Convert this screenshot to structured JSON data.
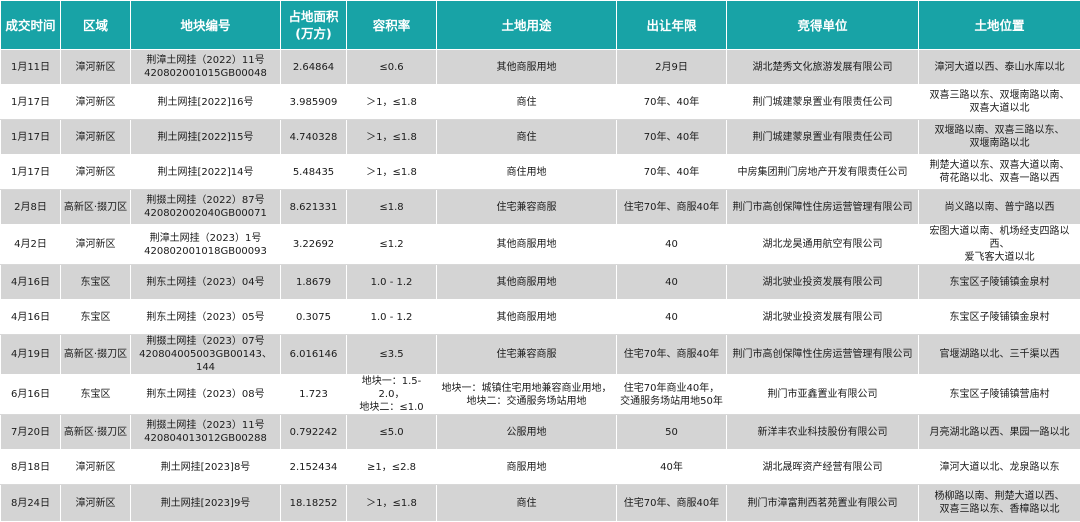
{
  "table": {
    "headers": [
      "成交时间",
      "区域",
      "地块编号",
      "占地面积\n(万方)",
      "容积率",
      "土地用途",
      "出让年限",
      "竞得单位",
      "土地位置"
    ],
    "rows": [
      [
        "1月11日",
        "漳河新区",
        "荆漳土网挂（2022）11号\n420802001015GB00048",
        "2.64864",
        "≤0.6",
        "其他商服用地",
        "2月9日",
        "湖北楚秀文化旅游发展有限公司",
        "漳河大道以西、泰山水库以北"
      ],
      [
        "1月17日",
        "漳河新区",
        "荆土网挂[2022]16号",
        "3.985909",
        "＞1，≤1.8",
        "商住",
        "70年、40年",
        "荆门城建蒙泉置业有限责任公司",
        "双喜三路以东、双堰南路以南、\n双喜大道以北"
      ],
      [
        "1月17日",
        "漳河新区",
        "荆土网挂[2022]15号",
        "4.740328",
        "＞1，≤1.8",
        "商住",
        "70年、40年",
        "荆门城建蒙泉置业有限责任公司",
        "双堰路以南、双喜三路以东、\n双堰南路以北"
      ],
      [
        "1月17日",
        "漳河新区",
        "荆土网挂[2022]14号",
        "5.48435",
        "＞1，≤1.8",
        "商住用地",
        "70年、40年",
        "中房集团荆门房地产开发有限责任公司",
        "荆楚大道以东、双喜大道以南、\n荷花路以北、双喜一路以西"
      ],
      [
        "2月8日",
        "高新区·掇刀区",
        "荆掇土网挂（2022）87号\n420802002040GB00071",
        "8.621331",
        "≤1.8",
        "住宅兼容商服",
        "住宅70年、商服40年",
        "荆门市高创保障性住房运营管理有限公司",
        "尚义路以南、普宁路以西"
      ],
      [
        "4月2日",
        "漳河新区",
        "荆漳土网挂（2023）1号\n420802001018GB00093",
        "3.22692",
        "≤1.2",
        "其他商服用地",
        "40",
        "湖北龙昊通用航空有限公司",
        "宏图大道以南、机场经支四路以西、\n爱飞客大道以北"
      ],
      [
        "4月16日",
        "东宝区",
        "荆东土网挂（2023）04号",
        "1.8679",
        "1.0 - 1.2",
        "其他商服用地",
        "40",
        "湖北驶业投资发展有限公司",
        "东宝区子陵铺镇金泉村"
      ],
      [
        "4月16日",
        "东宝区",
        "荆东土网挂（2023）05号",
        "0.3075",
        "1.0 - 1.2",
        "其他商服用地",
        "40",
        "湖北驶业投资发展有限公司",
        "东宝区子陵铺镇金泉村"
      ],
      [
        "4月19日",
        "高新区·掇刀区",
        "荆掇土网挂（2023）07号\n420804005003GB00143、144",
        "6.016146",
        "≤3.5",
        "住宅兼容商服",
        "住宅70年、商服40年",
        "荆门市高创保障性住房运营管理有限公司",
        "官堰湖路以北、三千渠以西"
      ],
      [
        "6月16日",
        "东宝区",
        "荆东土网挂（2023）08号",
        "1.723",
        "地块一：1.5-2.0，\n地块二：≤1.0",
        "地块一：城镇住宅用地兼容商业用地，\n地块二：交通服务场站用地",
        "住宅70年商业40年，\n交通服务场站用地50年",
        "荆门市亚鑫置业有限公司",
        "东宝区子陵铺镇营庙村"
      ],
      [
        "7月20日",
        "高新区·掇刀区",
        "荆掇土网挂（2023）11号\n420804013012GB00288",
        "0.792242",
        "≤5.0",
        "公服用地",
        "50",
        "新洋丰农业科技股份有限公司",
        "月亮湖北路以西、果园一路以北"
      ],
      [
        "8月18日",
        "漳河新区",
        "荆土网挂[2023]8号",
        "2.152434",
        "≥1，≤2.8",
        "商服用地",
        "40年",
        "湖北晟晖资产经营有限公司",
        "漳河大道以北、龙泉路以东"
      ],
      [
        "8月24日",
        "漳河新区",
        "荆土网挂[2023]9号",
        "18.18252",
        "＞1，≤1.8",
        "商住",
        "住宅70年、商服40年",
        "荆门市漳富荆西茗苑置业有限公司",
        "杨柳路以南、荆楚大道以西、\n双喜三路以东、香樟路以北"
      ]
    ]
  }
}
